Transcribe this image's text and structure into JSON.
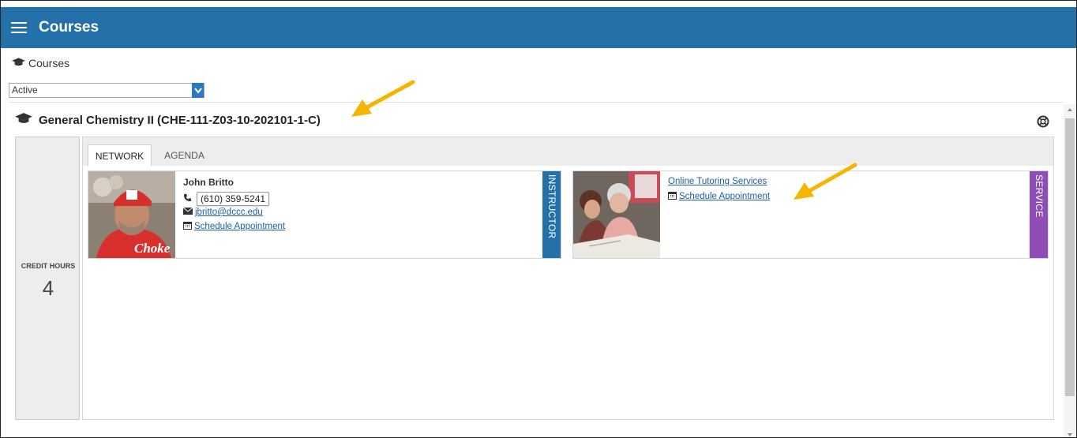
{
  "header": {
    "title": "Courses"
  },
  "breadcrumb": {
    "label": "Courses"
  },
  "filter": {
    "selected": "Active"
  },
  "course": {
    "title": "General Chemistry II (CHE-111-Z03-10-202101-1-C)",
    "credit_hours_label": "CREDIT HOURS",
    "credit_hours_value": "4",
    "tabs": [
      {
        "label": "NETWORK"
      },
      {
        "label": "AGENDA"
      }
    ],
    "cards": [
      {
        "name": "John Britto",
        "phone": "(610) 359-5241",
        "email": "jbritto@dccc.edu",
        "schedule_label": "Schedule Appointment",
        "role": "INSTRUCTOR",
        "role_color": "#2470a8"
      },
      {
        "name": "Online Tutoring Services",
        "schedule_label": "Schedule Appointment",
        "role": "SERVICE",
        "role_color": "#8f4db6"
      }
    ]
  },
  "colors": {
    "header": "#2470a8",
    "annotation_arrow": "#f5b400",
    "link": "#1f5fa8"
  }
}
